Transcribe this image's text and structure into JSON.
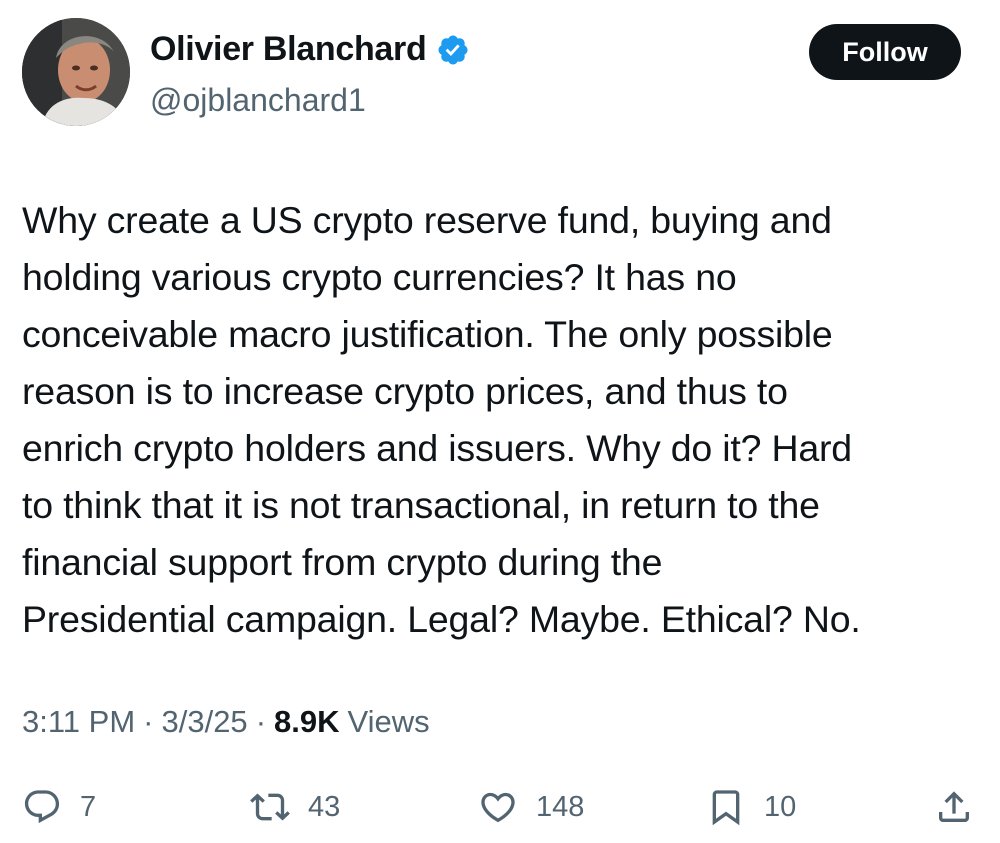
{
  "author": {
    "display_name": "Olivier Blanchard",
    "handle": "@ojblanchard1",
    "verified": true,
    "verified_color": "#1d9bf0"
  },
  "follow_label": "Follow",
  "tweet": {
    "lines": [
      "Why create a US crypto reserve fund, buying and",
      "holding various crypto currencies? It has no",
      "conceivable macro justification. The only possible",
      "reason is to increase crypto prices, and thus to",
      "enrich crypto holders and issuers. Why do it? Hard",
      "to think that it is not transactional, in return to the",
      "financial support from crypto during the",
      "Presidential campaign. Legal? Maybe. Ethical? No."
    ]
  },
  "meta": {
    "time": "3:11 PM",
    "separator": "·",
    "date": "3/3/25",
    "views_count": "8.9K",
    "views_label": "Views"
  },
  "actions": {
    "replies": "7",
    "reposts": "43",
    "likes": "148",
    "bookmarks": "10"
  },
  "icons": {
    "reply": "reply-icon",
    "repost": "repost-icon",
    "like": "heart-icon",
    "bookmark": "bookmark-icon",
    "share": "share-icon",
    "verified": "verified-badge-icon"
  },
  "colors": {
    "text": "#0f1419",
    "secondary": "#536471",
    "follow_bg": "#0f1419"
  }
}
